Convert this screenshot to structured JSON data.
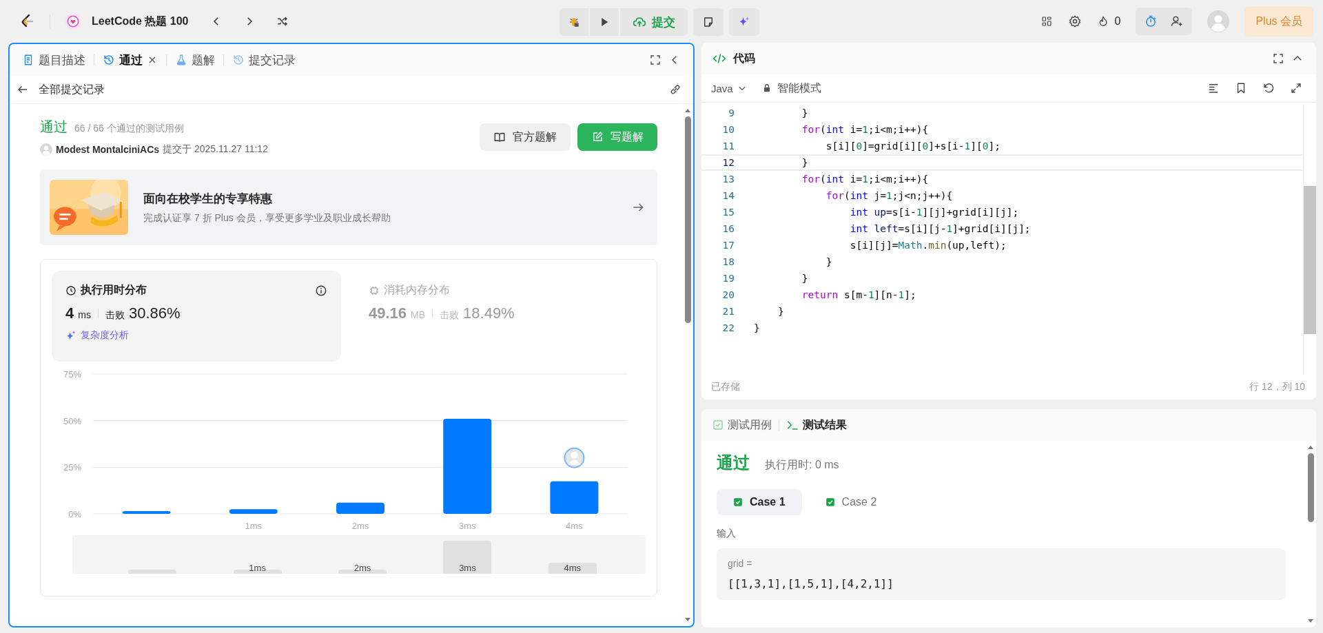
{
  "top_bar": {
    "title": "LeetCode 热题 100",
    "submit": "提交",
    "flame_count": "0",
    "plus": "Plus 会员"
  },
  "left_panel": {
    "tabs": [
      {
        "label": "题目描述",
        "kind": "description",
        "selected": false,
        "closable": false
      },
      {
        "label": "通过",
        "kind": "history",
        "selected": true,
        "closable": true
      },
      {
        "label": "题解",
        "kind": "flask",
        "selected": false,
        "closable": false
      },
      {
        "label": "提交记录",
        "kind": "history",
        "selected": false,
        "closable": false
      }
    ],
    "back_label": "全部提交记录",
    "submission": {
      "status": "通过",
      "cases": "66 / 66 个通过的测试用例",
      "user": "Modest MontalciniACs",
      "submitted": "提交于 2025.11.27 11:12",
      "buttons": [
        {
          "label": "官方题解",
          "kind": "secondary"
        },
        {
          "label": "写题解",
          "kind": "primary"
        }
      ]
    },
    "promo": {
      "title": "面向在校学生的专享特惠",
      "subtitle": "完成认证享 7 折 Plus 会员，享受更多学业及职业成长帮助"
    },
    "stats": [
      {
        "title": "执行用时分布",
        "kind": "runtime",
        "selected": true,
        "value": "4",
        "unit": "ms",
        "beat_label": "击败",
        "beat": "30.86%",
        "link": "复杂度分析"
      },
      {
        "title": "消耗内存分布",
        "kind": "memory",
        "selected": false,
        "value": "49.16",
        "unit": "MB",
        "beat_label": "击败",
        "beat": "18.49%"
      }
    ],
    "chart": {
      "chart_data": {
        "type": "bar",
        "x": [
          0,
          1,
          2,
          3,
          4
        ],
        "series": [
          {
            "color": "#007aff",
            "values": [
              1.5,
              2.5,
              6,
              51,
              17.5
            ]
          }
        ],
        "xlim": [
          -0.5,
          4.5
        ],
        "ylim": [
          0,
          75
        ],
        "yticks": [
          {
            "value": 0,
            "label": "0%"
          },
          {
            "value": 25,
            "label": "25%"
          },
          {
            "value": 50,
            "label": "50%"
          },
          {
            "value": 75,
            "label": "75%"
          }
        ],
        "xticks": [
          {
            "value": 1,
            "label": "1ms"
          },
          {
            "value": 2,
            "label": "2ms"
          },
          {
            "value": 3,
            "label": "3ms"
          },
          {
            "value": 4,
            "label": "4ms"
          }
        ]
      }
    },
    "brush_labels": [
      "1ms",
      "2ms",
      "3ms",
      "4ms"
    ]
  },
  "code_panel": {
    "title": "代码",
    "language": "Java",
    "mode": "智能模式",
    "lines": [
      {
        "number": "9",
        "current": false,
        "tokens": [
          {
            "text": "        }",
            "kind": "plain"
          }
        ]
      },
      {
        "number": "10",
        "current": false,
        "tokens": [
          {
            "text": "        for",
            "kind": "keyword"
          },
          {
            "text": "(",
            "kind": "plain"
          },
          {
            "text": "int",
            "kind": "type"
          },
          {
            "text": " i=",
            "kind": "plain"
          },
          {
            "text": "1",
            "kind": "number"
          },
          {
            "text": ";i<m;i++){",
            "kind": "plain"
          }
        ]
      },
      {
        "number": "11",
        "current": false,
        "tokens": [
          {
            "text": "            s[i][",
            "kind": "plain"
          },
          {
            "text": "0",
            "kind": "number"
          },
          {
            "text": "]=grid[i][",
            "kind": "plain"
          },
          {
            "text": "0",
            "kind": "number"
          },
          {
            "text": "]+s[i-",
            "kind": "plain"
          },
          {
            "text": "1",
            "kind": "number"
          },
          {
            "text": "][",
            "kind": "plain"
          },
          {
            "text": "0",
            "kind": "number"
          },
          {
            "text": "];",
            "kind": "plain"
          }
        ]
      },
      {
        "number": "12",
        "current": true,
        "tokens": [
          {
            "text": "        }",
            "kind": "plain"
          }
        ]
      },
      {
        "number": "13",
        "current": false,
        "tokens": [
          {
            "text": "        for",
            "kind": "keyword"
          },
          {
            "text": "(",
            "kind": "plain"
          },
          {
            "text": "int",
            "kind": "type"
          },
          {
            "text": " i=",
            "kind": "plain"
          },
          {
            "text": "1",
            "kind": "number"
          },
          {
            "text": ";i<m;i++){",
            "kind": "plain"
          }
        ]
      },
      {
        "number": "14",
        "current": false,
        "tokens": [
          {
            "text": "            for",
            "kind": "keyword"
          },
          {
            "text": "(",
            "kind": "plain"
          },
          {
            "text": "int",
            "kind": "type"
          },
          {
            "text": " j=",
            "kind": "plain"
          },
          {
            "text": "1",
            "kind": "number"
          },
          {
            "text": ";j<n;j++){",
            "kind": "plain"
          }
        ]
      },
      {
        "number": "15",
        "current": false,
        "tokens": [
          {
            "text": "                int",
            "kind": "type"
          },
          {
            "text": " up",
            "kind": "variable"
          },
          {
            "text": "=s[i-",
            "kind": "plain"
          },
          {
            "text": "1",
            "kind": "number"
          },
          {
            "text": "][j]+grid[i][j];",
            "kind": "plain"
          }
        ]
      },
      {
        "number": "16",
        "current": false,
        "tokens": [
          {
            "text": "                int",
            "kind": "type"
          },
          {
            "text": " left",
            "kind": "variable"
          },
          {
            "text": "=s[i][j-",
            "kind": "plain"
          },
          {
            "text": "1",
            "kind": "number"
          },
          {
            "text": "]+grid[i][j];",
            "kind": "plain"
          }
        ]
      },
      {
        "number": "17",
        "current": false,
        "tokens": [
          {
            "text": "                s[i][j]=",
            "kind": "plain"
          },
          {
            "text": "Math",
            "kind": "class"
          },
          {
            "text": ".",
            "kind": "plain"
          },
          {
            "text": "min",
            "kind": "function"
          },
          {
            "text": "(up,left);",
            "kind": "plain"
          }
        ]
      },
      {
        "number": "18",
        "current": false,
        "tokens": [
          {
            "text": "            }",
            "kind": "plain"
          }
        ]
      },
      {
        "number": "19",
        "current": false,
        "tokens": [
          {
            "text": "        }",
            "kind": "plain"
          }
        ]
      },
      {
        "number": "20",
        "current": false,
        "tokens": [
          {
            "text": "        return",
            "kind": "keyword"
          },
          {
            "text": " s[m-",
            "kind": "plain"
          },
          {
            "text": "1",
            "kind": "number"
          },
          {
            "text": "][n-",
            "kind": "plain"
          },
          {
            "text": "1",
            "kind": "number"
          },
          {
            "text": "];",
            "kind": "plain"
          }
        ]
      },
      {
        "number": "21",
        "current": false,
        "tokens": [
          {
            "text": "    }",
            "kind": "plain"
          }
        ]
      },
      {
        "number": "22",
        "current": false,
        "tokens": [
          {
            "text": "}",
            "kind": "plain"
          }
        ]
      }
    ],
    "status": "已存储",
    "position": "行 12，列 10"
  },
  "test_panel": {
    "tabs": [
      {
        "label": "测试用例",
        "kind": "cases",
        "selected": false
      },
      {
        "label": "测试结果",
        "kind": "result",
        "selected": true
      }
    ],
    "status": "通过",
    "runtime": "执行用时: 0 ms",
    "cases": [
      {
        "label": "Case 1",
        "selected": true,
        "passed": true
      },
      {
        "label": "Case 2",
        "selected": false,
        "passed": true
      }
    ],
    "input_label": "输入",
    "input": {
      "name": "grid =",
      "value": "[[1,3,1],[1,5,1],[4,2,1]]"
    }
  }
}
